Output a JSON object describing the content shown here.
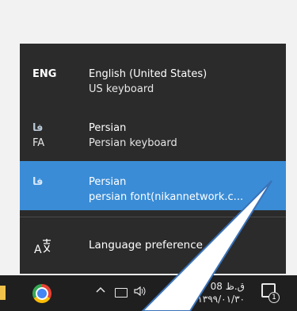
{
  "flyout": {
    "languages": [
      {
        "code": "ENG",
        "code_sub": "",
        "name": "English (United States)",
        "keyboard": "US keyboard",
        "selected": false
      },
      {
        "code": "فا",
        "code_sub": "FA",
        "name": "Persian",
        "keyboard": "Persian keyboard",
        "selected": false
      },
      {
        "code": "فا",
        "code_sub": "",
        "name": "Persian",
        "keyboard": "persian font(nikannetwork.c...",
        "selected": true
      }
    ],
    "preferences_label": "Language preference",
    "preferences_icon": "language-settings-icon"
  },
  "taskbar": {
    "tray": {
      "up_arrow": "^",
      "volume": "4)",
      "lang_indicator": "فا"
    },
    "clock": {
      "time": "ق.ظ 08",
      "date": "۱۳۹۹/۰۱/۳۰"
    },
    "notification_count": "1"
  },
  "colors": {
    "flyout_bg": "#2b2b2b",
    "selected_bg": "#3a8cd6",
    "taskbar_bg": "#1f1f1f"
  }
}
